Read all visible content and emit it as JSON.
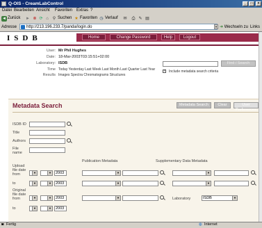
{
  "window": {
    "title": "Q-OIS - CreamLabControl"
  },
  "menu": {
    "items": [
      "Datei",
      "Bearbeiten",
      "Ansicht",
      "Favoriten",
      "Extras",
      "?"
    ]
  },
  "toolbar": {
    "back": "Zurück",
    "search": "Suchen",
    "favorites": "Favoriten",
    "history": "Verlauf"
  },
  "address": {
    "label": "Adresse",
    "url": "http://213.196.233.7/panda/login.do",
    "go": "Wechseln zu",
    "links": "Links"
  },
  "banner": {
    "logo": "ISDB"
  },
  "nav": {
    "home": "Home",
    "change_password": "Change Password",
    "help": "Help",
    "logout": "Logout"
  },
  "info": {
    "user_label": "User:",
    "user": "Mr Phil Hughes",
    "date_label": "Date:",
    "date": "18-Mar-2003T03:15:51+02:00",
    "lab_label": "Laboratory:",
    "lab": "ISDB",
    "time_label": "Time",
    "time": "Today Yesterday Last Week Last Month Last Quarter Last Year",
    "results_label": "Results",
    "results": "Images Spectra Chromatograms Structures",
    "include_label": "Include metadata search criteria",
    "find_button": "Find / Search"
  },
  "metadata": {
    "title": "Metadata Search",
    "buttons": {
      "search": "Metadata Search",
      "clear": "Clear",
      "user_prefs": "User Preferences"
    },
    "fields": {
      "isdb_id": "ISDB ID",
      "title": "Title",
      "authors": "Authors",
      "file_name": "File name"
    },
    "pub_header": "Publication Metadata",
    "supp_header": "Supplementary Data Metadata",
    "upload_label": "Upload file date from",
    "to_label": "to",
    "original_label": "Original file date from",
    "to_label2": "to",
    "year": "2003",
    "laboratory_label": "Laboratory",
    "laboratory_value": "ISDB"
  },
  "status": {
    "left": "Fertig",
    "right": "Internet"
  }
}
